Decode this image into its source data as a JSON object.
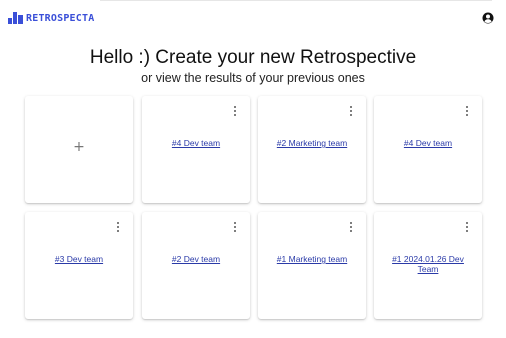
{
  "header": {
    "app_name": "RETROSPECTA",
    "brand_color": "#3a4fd8",
    "account_icon": "account-circle-icon"
  },
  "hero": {
    "title": "Hello :) Create your new Retrospective",
    "subtitle": "or view the results of your previous ones"
  },
  "new_card": {
    "icon": "plus-icon",
    "symbol": "+"
  },
  "retros": [
    {
      "label": "#4 Dev team"
    },
    {
      "label": "#2 Marketing team"
    },
    {
      "label": "#4 Dev team"
    },
    {
      "label": "#3 Dev team"
    },
    {
      "label": "#2 Dev team"
    },
    {
      "label": "#1 Marketing team"
    },
    {
      "label": "#1 2024.01.26 Dev Team"
    }
  ]
}
